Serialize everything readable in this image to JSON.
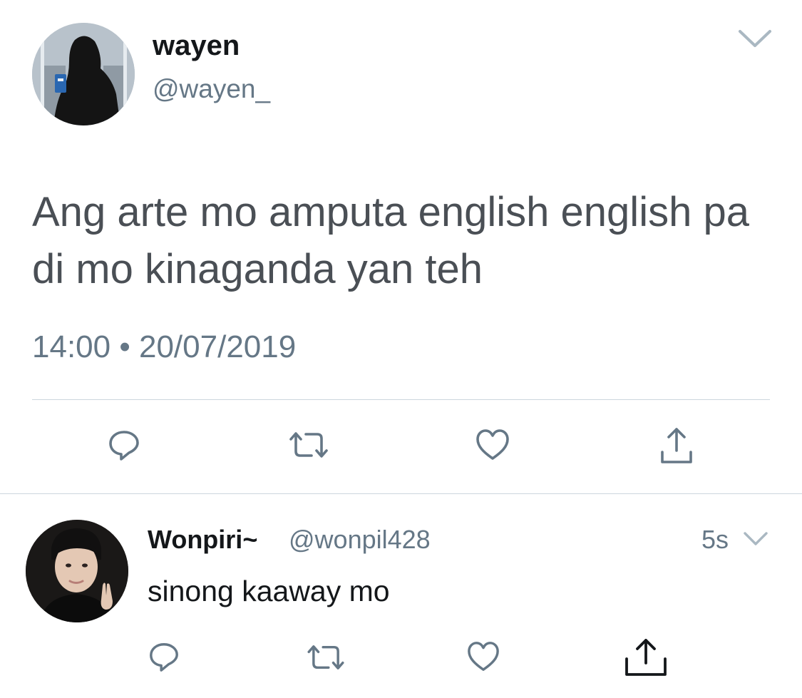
{
  "main_tweet": {
    "author": {
      "name": "wayen",
      "handle": "@wayen_",
      "avatar_icon": "avatar-silhouette-window"
    },
    "text": "Ang arte mo amputa english english pa di mo kinaganda yan teh",
    "time": "14:00",
    "separator": "•",
    "date": "20/07/2019",
    "actions": [
      "reply-icon",
      "retweet-icon",
      "like-icon",
      "share-icon"
    ]
  },
  "reply_tweet": {
    "author": {
      "name": "Wonpiri~",
      "handle": "@wonpil428",
      "avatar_icon": "avatar-person-peace-sign"
    },
    "time_ago": "5s",
    "text": "sinong kaaway mo",
    "actions": [
      "reply-icon",
      "retweet-icon",
      "like-icon",
      "share-icon"
    ]
  },
  "colors": {
    "text_primary": "#14171a",
    "text_secondary": "#657786",
    "tweet_text": "#4a4f55",
    "divider": "#ccd6dd",
    "icon": "#657786"
  }
}
